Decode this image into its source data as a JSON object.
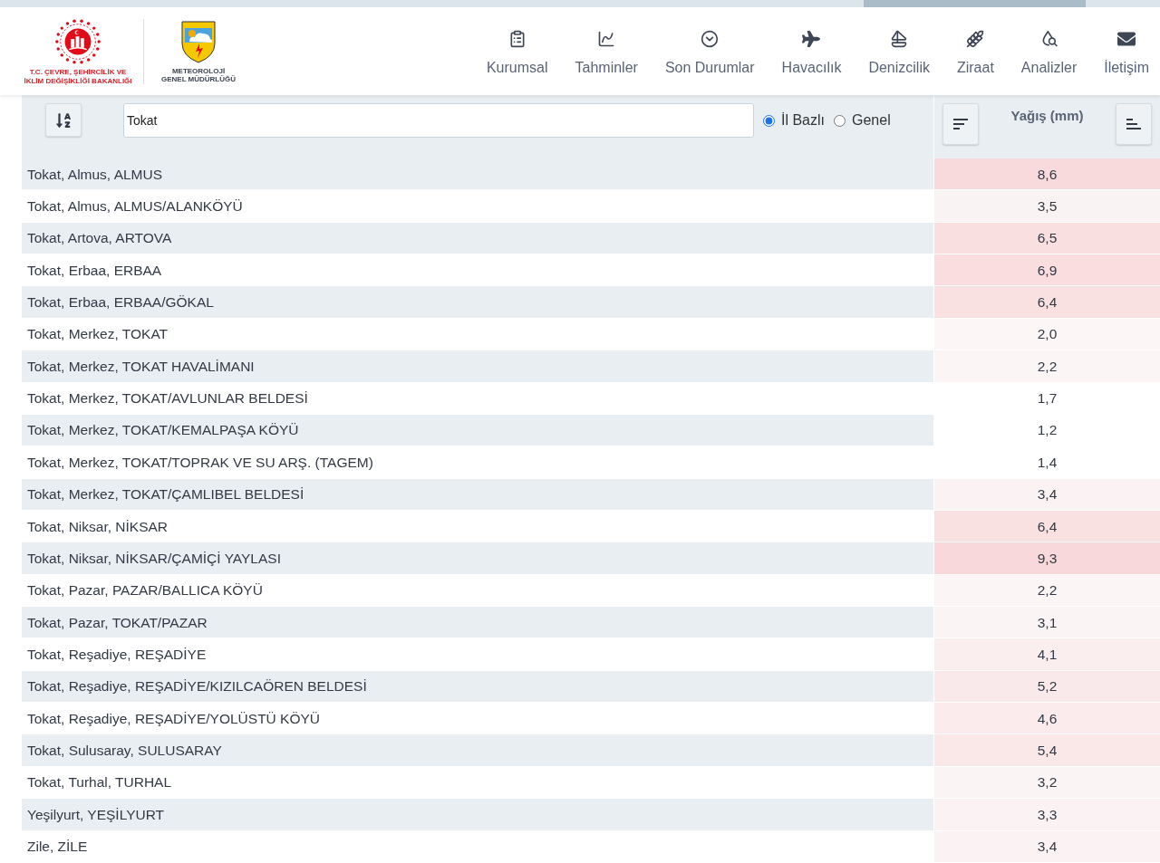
{
  "header": {
    "ministry_logo": {
      "lines": [
        "T.C. ÇEVRE, ŞEHİRCİLİK VE",
        "İKLİM DEĞİŞİKLİĞİ BAKANLIĞI"
      ]
    },
    "agency_logo": {
      "lines": [
        "METEOROLOJİ",
        "GENEL MÜDÜRLÜĞÜ"
      ]
    },
    "nav": [
      {
        "label": "Kurumsal"
      },
      {
        "label": "Tahminler"
      },
      {
        "label": "Son Durumlar"
      },
      {
        "label": "Havacılık"
      },
      {
        "label": "Denizcilik"
      },
      {
        "label": "Ziraat"
      },
      {
        "label": "Analizler"
      },
      {
        "label": "İletişim"
      }
    ]
  },
  "toolbar": {
    "search": {
      "value": "Tokat"
    },
    "radios": [
      {
        "label": "İl Bazlı",
        "selected": true
      },
      {
        "label": "Genel",
        "selected": false
      }
    ],
    "column_header": "Yağış (mm)"
  },
  "table": {
    "rows": [
      {
        "station": "Tokat, Almus, ALMUS",
        "value": "8,6",
        "color": "#f8dadc"
      },
      {
        "station": "Tokat, Almus, ALMUS/ALANKÖYÜ",
        "value": "3,5",
        "color": "#faf3f3"
      },
      {
        "station": "Tokat, Artova, ARTOVA",
        "value": "6,5",
        "color": "#f9dfe0"
      },
      {
        "station": "Tokat, Erbaa, ERBAA",
        "value": "6,9",
        "color": "#f9dddf"
      },
      {
        "station": "Tokat, Erbaa, ERBAA/GÖKAL",
        "value": "6,4",
        "color": "#f9e0e1"
      },
      {
        "station": "Tokat, Merkez, TOKAT",
        "value": "2,0",
        "color": "#fcf6f6"
      },
      {
        "station": "Tokat, Merkez, TOKAT HAVALİMANI",
        "value": "2,2",
        "color": "#fbf5f5"
      },
      {
        "station": "Tokat, Merkez, TOKAT/AVLUNLAR BELDESİ",
        "value": "1,7",
        "color": "#ffffff"
      },
      {
        "station": "Tokat, Merkez, TOKAT/KEMALPAŞA KÖYÜ",
        "value": "1,2",
        "color": "#ffffff"
      },
      {
        "station": "Tokat, Merkez, TOKAT/TOPRAK VE SU ARŞ. (TAGEM)",
        "value": "1,4",
        "color": "#ffffff"
      },
      {
        "station": "Tokat, Merkez, TOKAT/ÇAMLIBEL BELDESİ",
        "value": "3,4",
        "color": "#fbf3f3"
      },
      {
        "station": "Tokat, Niksar, NİKSAR",
        "value": "6,4",
        "color": "#f9e0e1"
      },
      {
        "station": "Tokat, Niksar, NİKSAR/ÇAMİÇİ YAYLASI",
        "value": "9,3",
        "color": "#f8d8da"
      },
      {
        "station": "Tokat, Pazar, PAZAR/BALLICA KÖYÜ",
        "value": "2,2",
        "color": "#fbf5f5"
      },
      {
        "station": "Tokat, Pazar, TOKAT/PAZAR",
        "value": "3,1",
        "color": "#fbf4f4"
      },
      {
        "station": "Tokat, Reşadiye, REŞADİYE",
        "value": "4,1",
        "color": "#fbeeee"
      },
      {
        "station": "Tokat, Reşadiye, REŞADİYE/KIZILCAÖREN BELDESİ",
        "value": "5,2",
        "color": "#fae9ea"
      },
      {
        "station": "Tokat, Reşadiye, REŞADİYE/YOLÜSTÜ KÖYÜ",
        "value": "4,6",
        "color": "#fbebec"
      },
      {
        "station": "Tokat, Sulusaray, SULUSARAY",
        "value": "5,4",
        "color": "#fae8e9"
      },
      {
        "station": "Tokat, Turhal, TURHAL",
        "value": "3,2",
        "color": "#fbf4f4"
      },
      {
        "station": "Yeşilyurt, YEŞİLYURT",
        "value": "3,3",
        "color": "#fbf3f3"
      },
      {
        "station": "Zile, ZİLE",
        "value": "3,4",
        "color": "#fbf3f3"
      }
    ]
  }
}
